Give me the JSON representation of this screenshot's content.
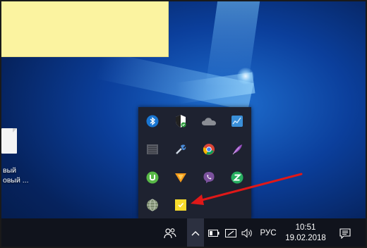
{
  "desktop": {
    "icon_label_line1": "вый",
    "icon_label_line2": "овый ..."
  },
  "tray": {
    "icons": [
      "bluetooth-icon",
      "windows-defender-icon",
      "onedrive-icon",
      "network-monitor-icon",
      "display-adapter-icon",
      "tool-icon",
      "chrome-icon",
      "feather-icon",
      "utorrent-icon",
      "avast-icon",
      "viber-icon",
      "zona-icon",
      "globe-icon",
      "sticky-notes-icon"
    ]
  },
  "taskbar": {
    "language": "РУС",
    "time": "10:51",
    "date": "19.02.2018"
  },
  "colors": {
    "annotation_arrow": "#e01818",
    "sticky_note": "#fbf3a0",
    "taskbar": "#10131c"
  }
}
